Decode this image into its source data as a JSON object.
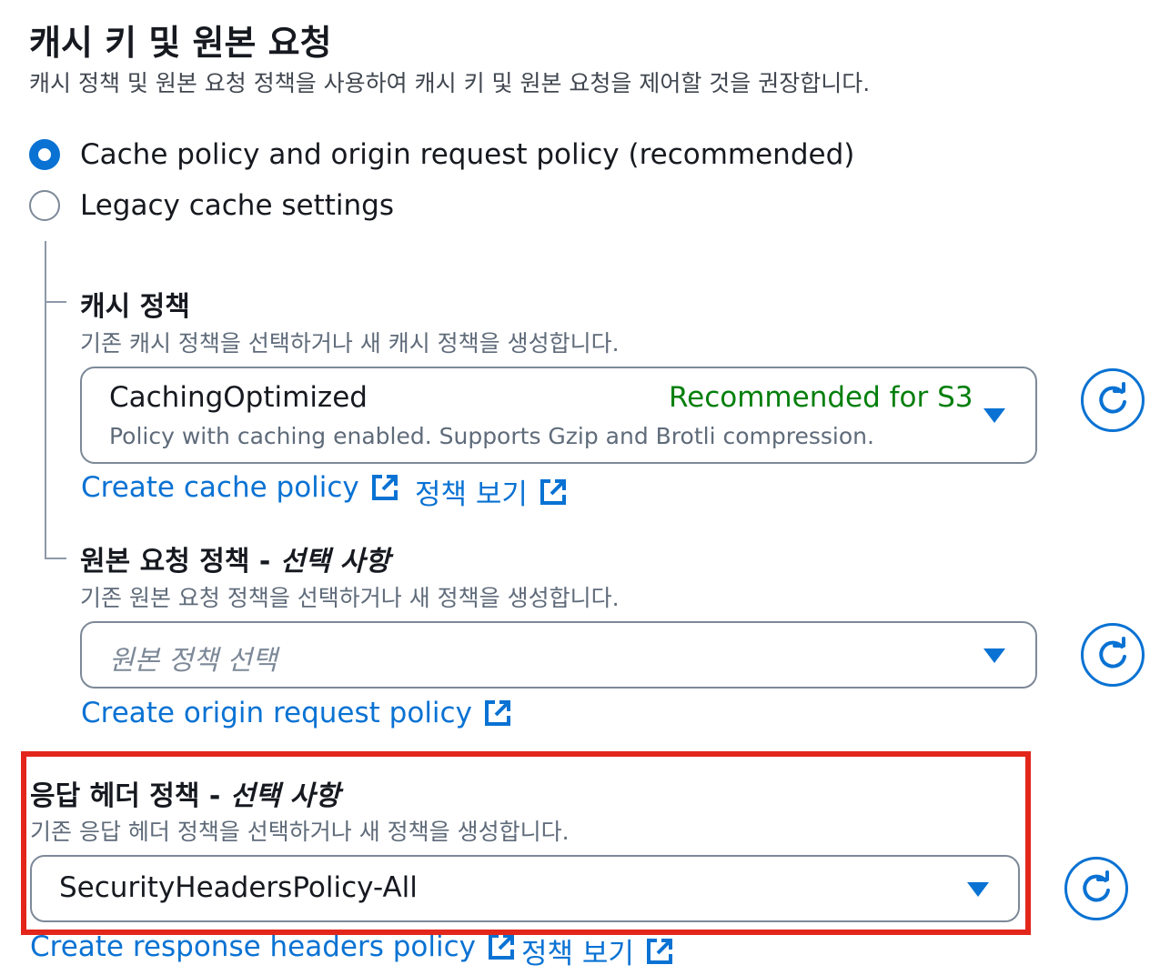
{
  "section": {
    "title": "캐시 키 및 원본 요청",
    "description": "캐시 정책 및 원본 요청 정책을 사용하여 캐시 키 및 원본 요청을 제어할 것을 권장합니다."
  },
  "radio_options": [
    {
      "label": "Cache policy and origin request policy (recommended)",
      "checked": true
    },
    {
      "label": "Legacy cache settings",
      "checked": false
    }
  ],
  "cache_policy": {
    "label": "캐시 정책",
    "description": "기존 캐시 정책을 선택하거나 새 캐시 정책을 생성합니다.",
    "selected_name": "CachingOptimized",
    "selected_tag": "Recommended for S3",
    "selected_description": "Policy with caching enabled. Supports Gzip and Brotli compression.",
    "create_link": "Create cache policy",
    "view_link": "정책 보기"
  },
  "origin_request_policy": {
    "label": "원본 요청 정책 - ",
    "label_optional": "선택 사항",
    "description": "기존 원본 요청 정책을 선택하거나 새 정책을 생성합니다.",
    "placeholder": "원본 정책 선택",
    "create_link": "Create origin request policy"
  },
  "response_headers_policy": {
    "label": "응답 헤더 정책 - ",
    "label_optional": "선택 사항",
    "description": "기존 응답 헤더 정책을 선택하거나 새 정책을 생성합니다.",
    "selected_name": "SecurityHeadersPolicy-All",
    "create_link": "Create response headers policy",
    "view_link": "정책 보기"
  },
  "colors": {
    "accent": "#0972d3",
    "tag_green": "#037f0c",
    "highlight": "#e3261b"
  },
  "icons": {
    "external_link": "external-link-icon",
    "refresh": "refresh-icon",
    "dropdown": "caret-down-icon"
  }
}
